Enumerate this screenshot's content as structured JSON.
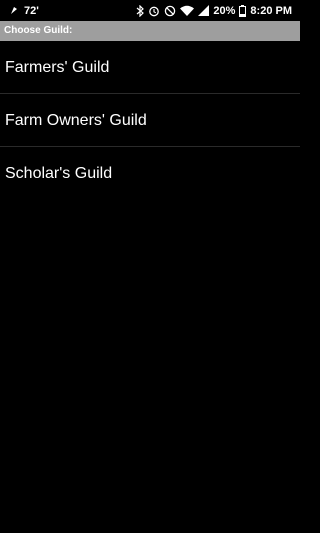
{
  "status_bar": {
    "temperature": "72'",
    "battery_percent": "20%",
    "time": "8:20 PM",
    "icons": [
      "notification-icon",
      "bluetooth-icon",
      "alarm-icon",
      "do-not-disturb-icon",
      "wifi-icon",
      "signal-icon",
      "battery-icon"
    ]
  },
  "dialog": {
    "title": "Choose Guild:",
    "header_color": "#9e9e9e"
  },
  "guilds": [
    {
      "label": "Farmers' Guild"
    },
    {
      "label": "Farm Owners' Guild"
    },
    {
      "label": "Scholar's Guild"
    }
  ]
}
